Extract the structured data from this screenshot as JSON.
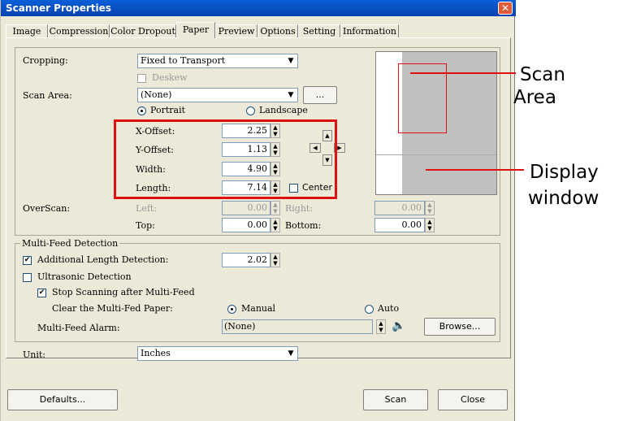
{
  "window": {
    "title": "Scanner Properties",
    "close_symbol": "✕"
  },
  "tabs": [
    {
      "label": "Image"
    },
    {
      "label": "Compression"
    },
    {
      "label": "Color Dropout"
    },
    {
      "label": "Paper",
      "active": true
    },
    {
      "label": "Preview"
    },
    {
      "label": "Options"
    },
    {
      "label": "Setting"
    },
    {
      "label": "Information"
    }
  ],
  "paper": {
    "cropping_label": "Cropping:",
    "cropping_value": "Fixed to Transport",
    "deskew_label": "Deskew",
    "scan_area_label": "Scan Area:",
    "scan_area_value": "(None)",
    "more_button": "...",
    "portrait_label": "Portrait",
    "landscape_label": "Landscape",
    "orientation_selected": "Portrait",
    "x_offset_label": "X-Offset:",
    "x_offset_value": "2.25",
    "y_offset_label": "Y-Offset:",
    "y_offset_value": "1.13",
    "width_label": "Width:",
    "width_value": "4.90",
    "length_label": "Length:",
    "length_value": "7.14",
    "center_label": "Center",
    "overscan_label": "OverScan:",
    "left_label": "Left:",
    "left_value": "0.00",
    "right_label": "Right:",
    "right_value": "0.00",
    "top_label": "Top:",
    "top_value": "0.00",
    "bottom_label": "Bottom:",
    "bottom_value": "0.00"
  },
  "multifeed": {
    "group_label": "Multi-Feed Detection",
    "additional_length_label": "Additional Length Detection:",
    "additional_length_checked": true,
    "additional_length_value": "2.02",
    "ultrasonic_label": "Ultrasonic Detection",
    "ultrasonic_checked": false,
    "stop_scanning_label": "Stop Scanning after Multi-Feed",
    "stop_scanning_checked": true,
    "clear_label": "Clear the Multi-Fed Paper:",
    "manual_label": "Manual",
    "auto_label": "Auto",
    "clear_selected": "Manual",
    "alarm_label": "Multi-Feed Alarm:",
    "alarm_value": "(None)",
    "browse_button": "Browse..."
  },
  "unit": {
    "label": "Unit:",
    "value": "Inches"
  },
  "buttons": {
    "defaults": "Defaults...",
    "scan": "Scan",
    "close": "Close"
  },
  "annotations": {
    "scan_area_line1": "Scan",
    "scan_area_line2": "Area",
    "display_line1": "Display",
    "display_line2": "window"
  },
  "colors": {
    "highlight": "#e01010",
    "title_bar": "#0a5fd8",
    "preview_bg": "#c0c0c0"
  }
}
